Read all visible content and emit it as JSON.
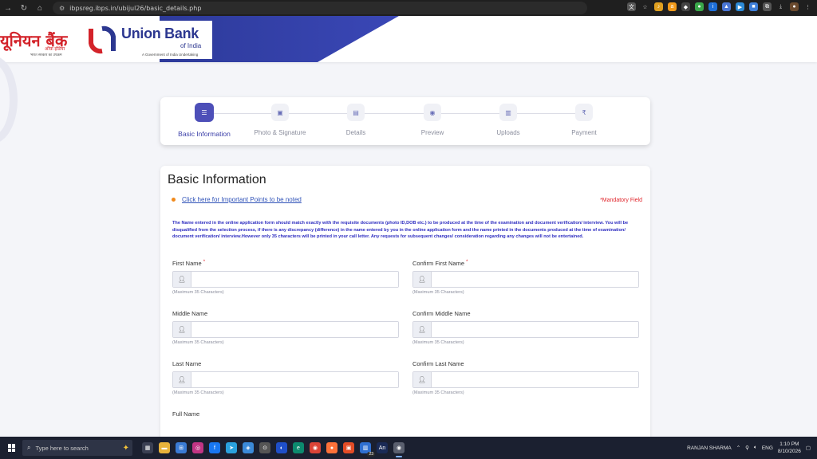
{
  "browser": {
    "url": "ibpsreg.ibps.in/ubijul26/basic_details.php",
    "nav_icons": [
      "back-icon",
      "forward-icon",
      "reload-icon",
      "home-icon"
    ]
  },
  "header": {
    "logo_hindi": "यूनियन बैंक",
    "logo_hindi_sub": "ऑफ़ इंडिया",
    "logo_hindi_tag": "भारत सरकार का उपक्रम",
    "logo_english": "Union Bank",
    "logo_english_sub": "of India",
    "logo_gov": "A Government of India Undertaking",
    "brand_color": "#2c3790",
    "accent_color": "#d3232a"
  },
  "stepper": {
    "steps": [
      {
        "label": "Basic Information",
        "icon": "list-icon",
        "active": true
      },
      {
        "label": "Photo & Signature",
        "icon": "image-icon",
        "active": false
      },
      {
        "label": "Details",
        "icon": "document-icon",
        "active": false
      },
      {
        "label": "Preview",
        "icon": "eye-icon",
        "active": false
      },
      {
        "label": "Uploads",
        "icon": "upload-file-icon",
        "active": false
      },
      {
        "label": "Payment",
        "icon": "rupee-icon",
        "active": false
      }
    ]
  },
  "form": {
    "title": "Basic Information",
    "important_link": "Click here for Important Points to be noted",
    "mandatory_note": "*Mandatory Field",
    "notice": "The Name entered in the online application form should match exactly with the requisite documents (photo ID,DOB etc.) to be produced at the time of the examination and document verification/ interview. You will be disqualified from the selection process, if there is any discrepancy (difference) in the name entered by you in the online application form and the name printed in the documents produced at the time of examination/ document verification/ interview.However only 35 characters will be printed in your call letter. Any requests for subsequent changes/ consideration regarding any changes will not be entertained.",
    "fields": {
      "first_name": {
        "label": "First Name",
        "required_mark": "*",
        "value": "",
        "hint": "(Maximum 35 Characters)"
      },
      "confirm_first_name": {
        "label": "Confirm First Name",
        "required_mark": "*",
        "value": "",
        "hint": "(Maximum 35 Characters)"
      },
      "middle_name": {
        "label": "Middle Name",
        "value": "",
        "hint": "(Maximum 35 Characters)"
      },
      "confirm_middle_name": {
        "label": "Confirm Middle Name",
        "value": "",
        "hint": "(Maximum 35 Characters)"
      },
      "last_name": {
        "label": "Last Name",
        "value": "",
        "hint": "(Maximum 35 Characters)"
      },
      "confirm_last_name": {
        "label": "Confirm Last Name",
        "value": "",
        "hint": "(Maximum 35 Characters)"
      },
      "full_name": {
        "label": "Full Name",
        "value": ""
      }
    }
  },
  "taskbar": {
    "search_placeholder": "Type here to search",
    "user": "RANJAN SHARMA",
    "language": "ENG",
    "time": "1:10 PM",
    "date": "8/10/2026",
    "badge_count": "23"
  }
}
